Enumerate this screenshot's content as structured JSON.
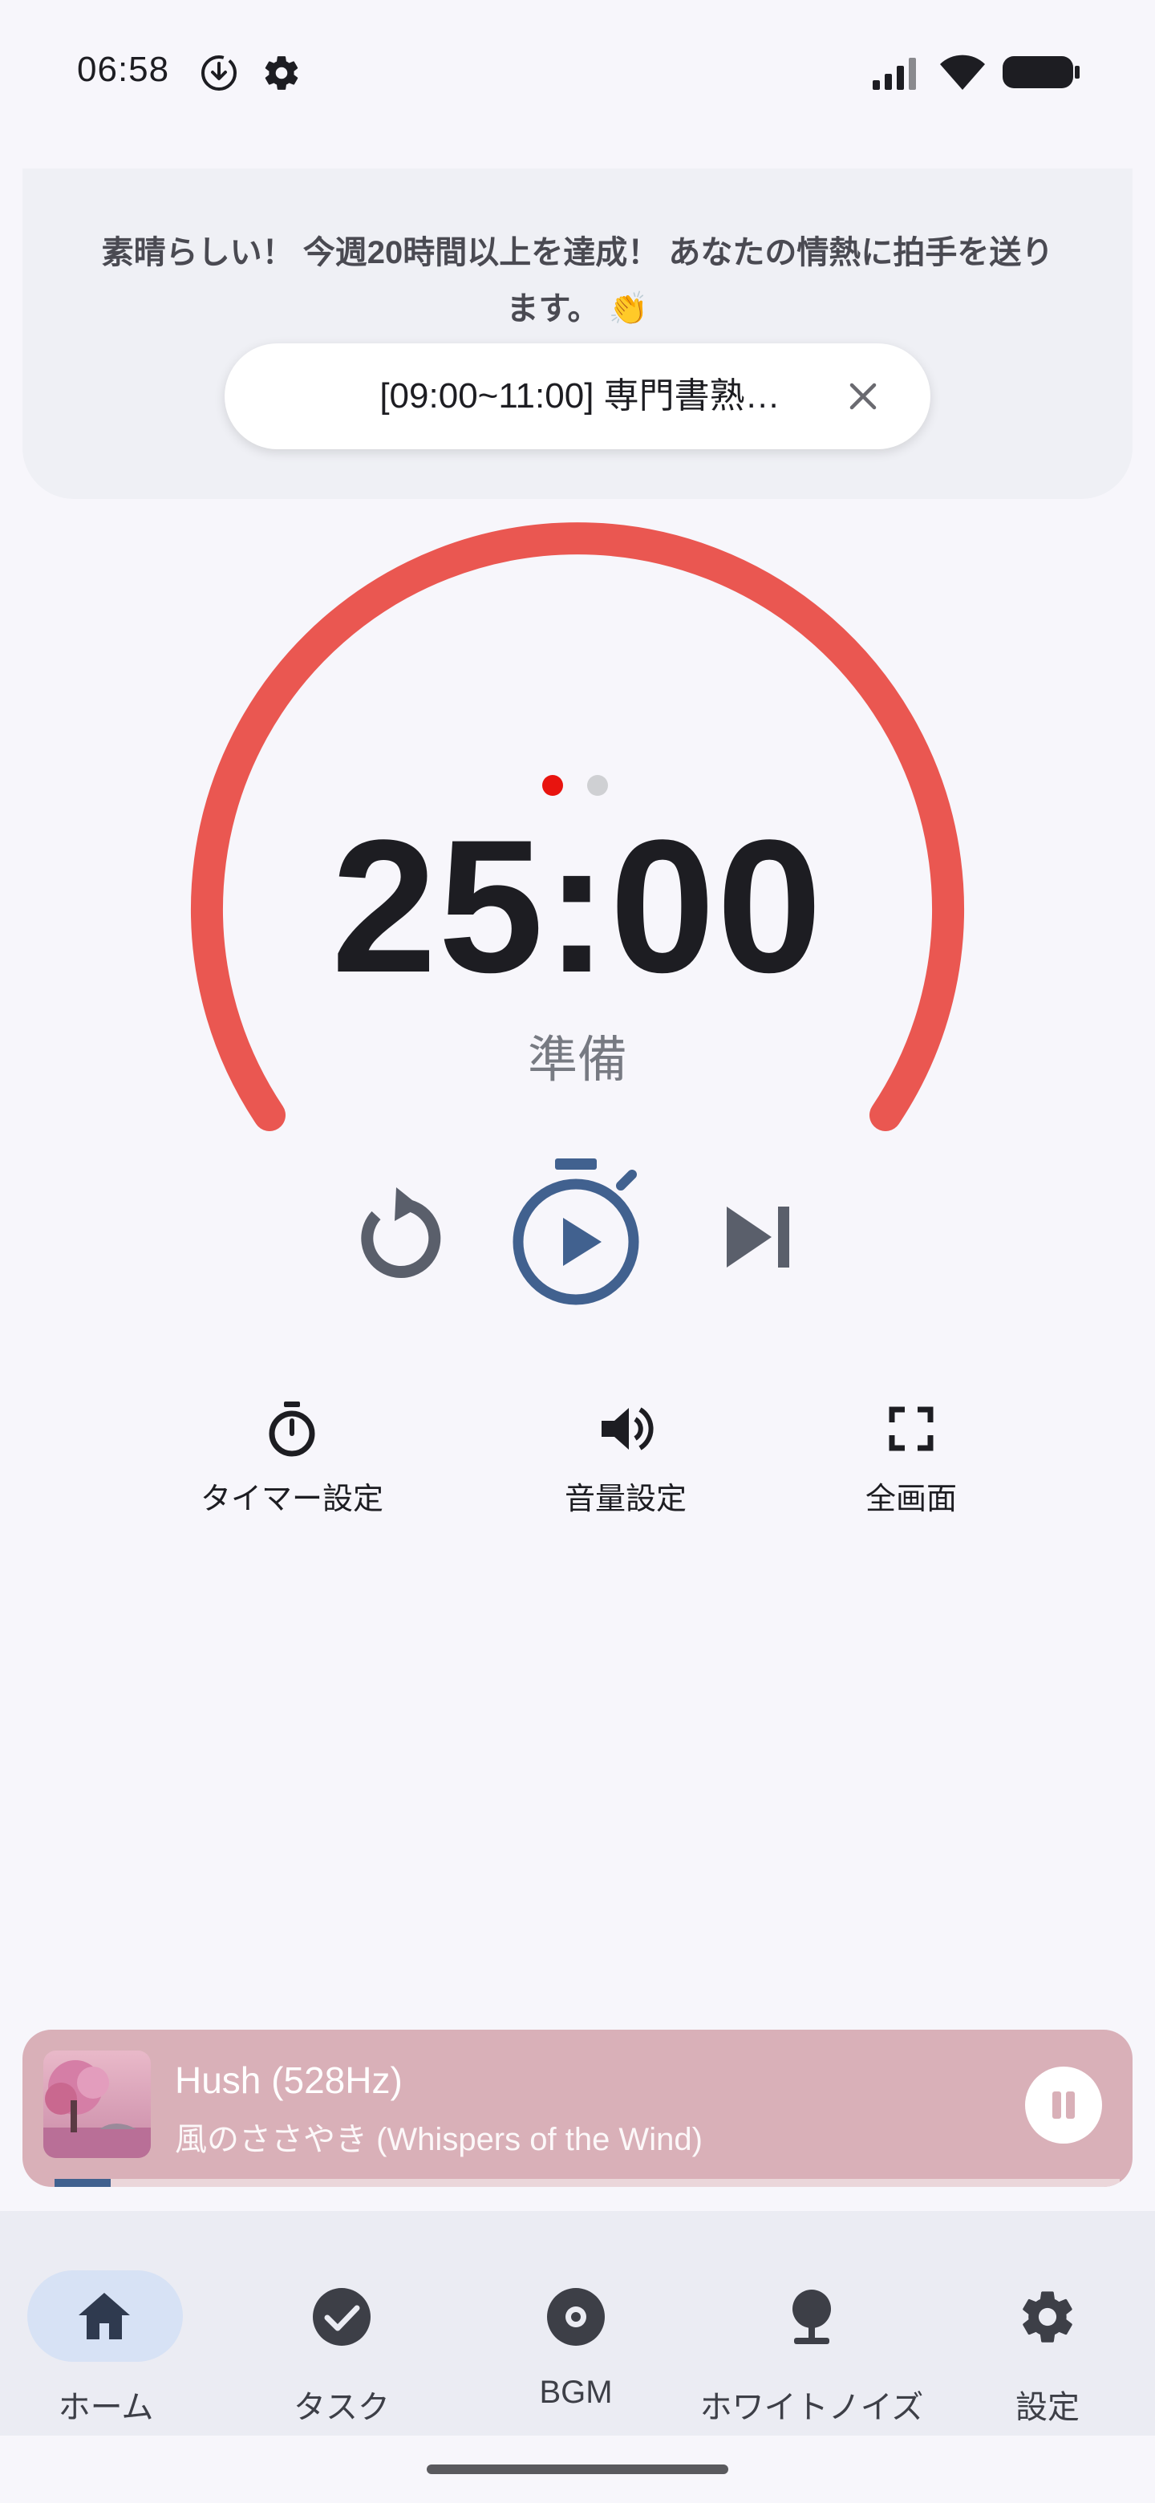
{
  "status_bar": {
    "time": "06:58",
    "icons": [
      "download-icon",
      "settings-gear-icon",
      "signal-icon",
      "wifi-icon",
      "battery-icon"
    ]
  },
  "banner": {
    "message_line1": "素晴らしい！ 今週20時間以上を達成！ あなたの情熱に拍手を送り",
    "message_line2": "ます。 👏",
    "current_task": "[09:00~11:00] 専門書熟…"
  },
  "timer": {
    "time": "25:00",
    "state": "準備",
    "page_indicator": {
      "active_index": 0,
      "count": 2
    },
    "colors": {
      "ring": "#ea5751",
      "primary": "#41618f",
      "controls": "#5a5f6b",
      "active_dot": "#e8140f",
      "inactive_dot": "#cfd0d3"
    }
  },
  "controls": {
    "icons": [
      "reset-icon",
      "start-stopwatch-play-icon",
      "skip-next-icon"
    ]
  },
  "options": [
    {
      "label": "タイマー設定",
      "icon": "timer-icon"
    },
    {
      "label": "音量設定",
      "icon": "volume-icon"
    },
    {
      "label": "全画面",
      "icon": "fullscreen-icon"
    }
  ],
  "player": {
    "title": "Hush (528Hz)",
    "subtitle": "風のささやき (Whispers of the Wind)",
    "progress": 0.053,
    "is_playing": true,
    "background": "#d9b0b8"
  },
  "bottom_nav": {
    "items": [
      {
        "label": "ホーム",
        "icon": "home-icon",
        "active": true
      },
      {
        "label": "タスク",
        "icon": "check-circle-icon",
        "active": false
      },
      {
        "label": "BGM",
        "icon": "disc-icon",
        "active": false
      },
      {
        "label": "ホワイトノイズ",
        "icon": "noise-tree-icon",
        "active": false
      },
      {
        "label": "設定",
        "icon": "settings-icon",
        "active": false
      }
    ]
  }
}
